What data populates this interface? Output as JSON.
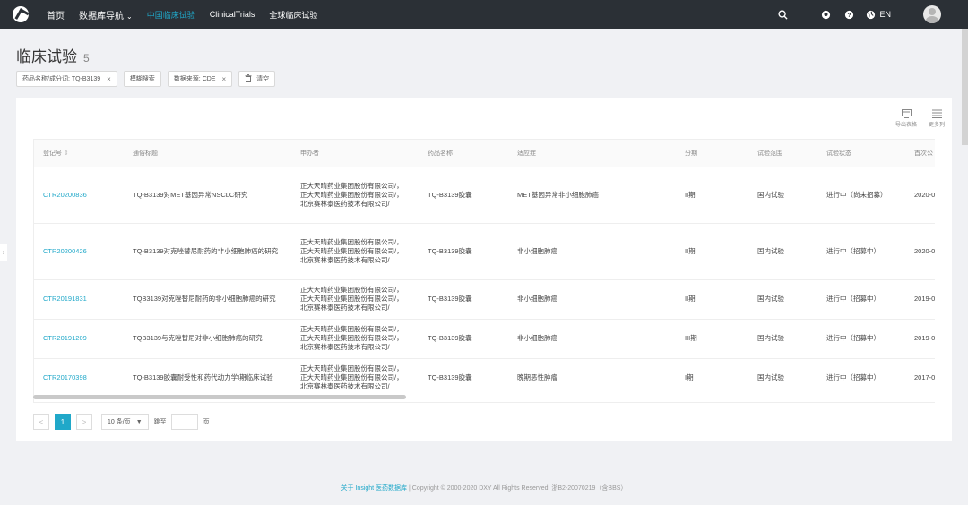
{
  "nav": {
    "home": "首页",
    "db_nav": "数据库导航",
    "tab_cn": "中国临床试验",
    "tab_ct": "ClinicalTrials",
    "tab_global": "全球临床试验",
    "lang": "EN"
  },
  "page": {
    "title": "临床试验",
    "count": "5"
  },
  "filters": [
    {
      "label": "药品名称/成分词: TQ-B3139",
      "close": "×"
    },
    {
      "label": "模糊搜索"
    },
    {
      "label": "数据来源: CDE",
      "close": "×"
    },
    {
      "label": "清空"
    }
  ],
  "tools": {
    "export": "导出表格",
    "more": "更多列"
  },
  "table": {
    "headers": [
      "登记号",
      "通俗标题",
      "申办者",
      "药品名称",
      "适应症",
      "分期",
      "试验范围",
      "试验状态",
      "首次公"
    ],
    "rows": [
      [
        "CTR20200836",
        "TQ-B3139对MET基因异常NSCLC研究",
        "正大天晴药业集团股份有限公司/，\n正大天晴药业集团股份有限公司/，\n北京赛林泰医药技术有限公司/",
        "TQ-B3139胶囊",
        "MET基因异常非小细胞肺癌",
        "II期",
        "国内试验",
        "进行中（尚未招募）",
        "2020-0"
      ],
      [
        "CTR20200426",
        "TQ-B3139对克唑替尼耐药的非小细胞肺癌的研究",
        "正大天晴药业集团股份有限公司/，\n正大天晴药业集团股份有限公司/，\n北京赛林泰医药技术有限公司/",
        "TQ-B3139胶囊",
        "非小细胞肺癌",
        "II期",
        "国内试验",
        "进行中（招募中）",
        "2020-0"
      ],
      [
        "CTR20191831",
        "TQB3139对克唑替尼耐药的非小细胞肺癌的研究",
        "正大天晴药业集团股份有限公司/，\n正大天晴药业集团股份有限公司/，\n北京赛林泰医药技术有限公司/",
        "TQ-B3139胶囊",
        "非小细胞肺癌",
        "II期",
        "国内试验",
        "进行中（招募中）",
        "2019-0"
      ],
      [
        "CTR20191209",
        "TQB3139与克唑替尼对非小细胞肺癌的研究",
        "正大天晴药业集团股份有限公司/，\n正大天晴药业集团股份有限公司/，\n北京赛林泰医药技术有限公司/",
        "TQ-B3139胶囊",
        "非小细胞肺癌",
        "III期",
        "国内试验",
        "进行中（招募中）",
        "2019-0"
      ],
      [
        "CTR20170398",
        "TQ-B3139胶囊耐受性和药代动力学I期临床试验",
        "正大天晴药业集团股份有限公司/，\n正大天晴药业集团股份有限公司/，\n北京赛林泰医药技术有限公司/",
        "TQ-B3139胶囊",
        "晚期恶性肿瘤",
        "I期",
        "国内试验",
        "进行中（招募中）",
        "2017-0"
      ]
    ]
  },
  "pager": {
    "prev": "<",
    "current": "1",
    "next": ">",
    "page_size": "10 条/页",
    "jump_label": "跳至",
    "page_unit": "页"
  },
  "footer": {
    "about": "关于 Insight 医药数据库",
    "copyright": " | Copyright © 2000-2020 DXY All Rights Reserved. 浙B2-20070219（含BBS）"
  },
  "side_arrow": "›"
}
